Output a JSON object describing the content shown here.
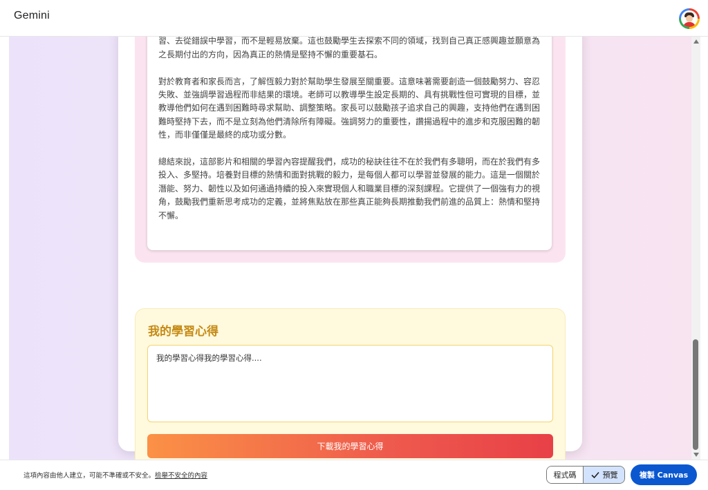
{
  "app": {
    "title": "Gemini"
  },
  "summary": {
    "paragraphs": [
      "練、以及需要大量重複練習的內容，擁有恆毅力意味著即使面對這些情況，依然願意努力去理解、去練習、去從錯誤中學習，而不是輕易放棄。這也鼓勵學生去探索不同的領域，找到自己真正感興趣並願意為之長期付出的方向，因為真正的熱情是堅持不懈的重要基石。",
      "對於教育者和家長而言，了解恆毅力對於幫助學生發展至關重要。這意味著需要創造一個鼓勵努力、容忍失敗、並強調學習過程而非結果的環境。老師可以教導學生設定長期的、具有挑戰性但可實現的目標，並教導他們如何在遇到困難時尋求幫助、調整策略。家長可以鼓勵孩子追求自己的興趣，支持他們在遇到困難時堅持下去，而不是立刻為他們清除所有障礙。強調努力的重要性，讚揚過程中的進步和克服困難的韌性，而非僅僅是最終的成功或分數。",
      "總結來說，這部影片和相關的學習內容提醒我們，成功的秘訣往往不在於我們有多聰明，而在於我們有多投入、多堅持。培養對目標的熱情和面對挑戰的毅力，是每個人都可以學習並發展的能力。這是一個關於潛能、努力、韌性以及如何通過持續的投入來實現個人和職業目標的深刻課程。它提供了一個強有力的視角，鼓勵我們重新思考成功的定義，並將焦點放在那些真正能夠長期推動我們前進的品質上：熱情和堅持不懈。"
    ]
  },
  "reflection": {
    "title": "我的學習心得",
    "textarea_value": "我的學習心得我的學習心得....",
    "download_label": "下載我的學習心得"
  },
  "footer": {
    "notice_text": "這項內容由他人建立，可能不準確或不安全。",
    "report_link": "檢舉不安全的內容",
    "code_label": "程式碼",
    "preview_label": "預覽",
    "copy_label": "複製 Canvas"
  },
  "colors": {
    "accent": "#0b57d0",
    "reflection_title": "#c58a14",
    "button_start": "#fb9146",
    "button_end": "#e84047"
  }
}
